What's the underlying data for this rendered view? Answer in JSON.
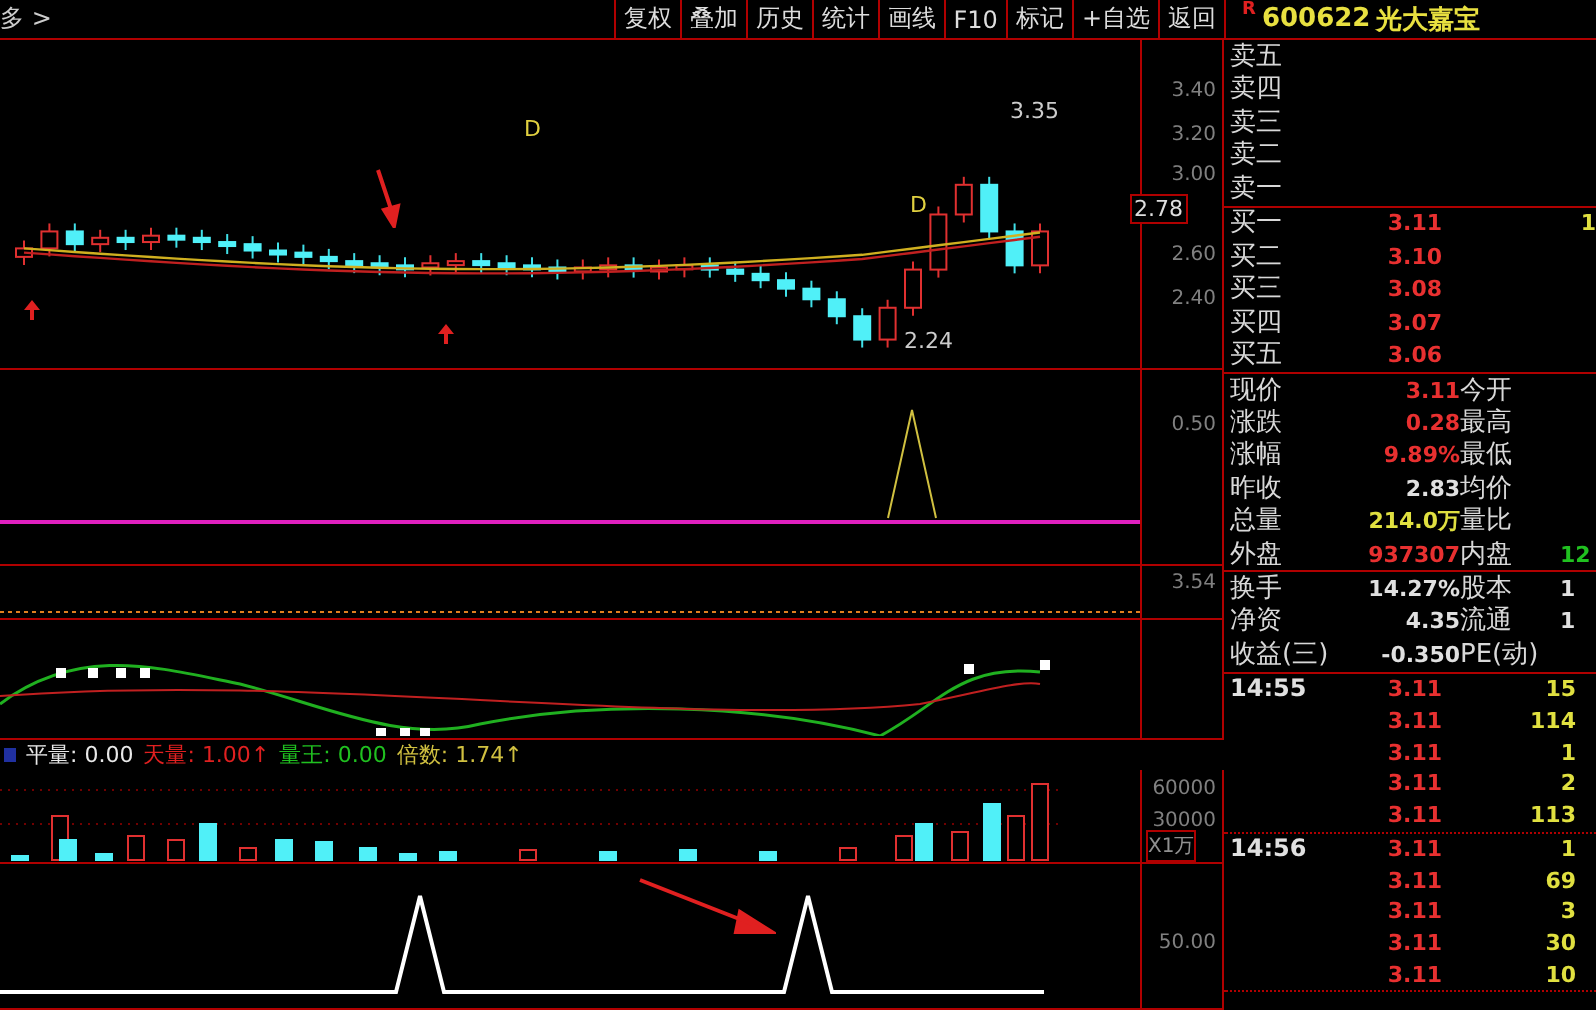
{
  "toolbar": {
    "back_label": "多 >",
    "buttons": [
      "复权",
      "叠加",
      "历史",
      "统计",
      "画线",
      "F10",
      "标记",
      "+自选",
      "返回"
    ]
  },
  "stock": {
    "badge": "R",
    "code": "600622",
    "name": "光大嘉宝"
  },
  "price_panel": {
    "ticks": [
      "3.40",
      "3.20",
      "3.00",
      "2.60",
      "2.40"
    ],
    "last_price": "2.78",
    "markers": [
      {
        "text": "D",
        "kind": "signal"
      },
      {
        "text": "D",
        "kind": "signal"
      },
      {
        "text": "3.35",
        "kind": "high"
      },
      {
        "text": "2.24",
        "kind": "low"
      }
    ]
  },
  "signal_panel": {
    "tick": "0.50"
  },
  "line_panel": {
    "tick": "3.54"
  },
  "volume_panel": {
    "legend": [
      {
        "label": "平量:",
        "value": "0.00",
        "color": "#e8e8e8"
      },
      {
        "label": "天量:",
        "value": "1.00",
        "color": "#e02020",
        "arrow": "↑"
      },
      {
        "label": "量王:",
        "value": "0.00",
        "color": "#20c020"
      },
      {
        "label": "倍数:",
        "value": "1.74",
        "color": "#d0c040",
        "arrow": "↑"
      }
    ],
    "ticks": [
      "60000",
      "30000"
    ],
    "unit": "X1万"
  },
  "bottom_panel": {
    "tick": "50.00"
  },
  "order_book": {
    "sells": [
      {
        "label": "卖五"
      },
      {
        "label": "卖四"
      },
      {
        "label": "卖三"
      },
      {
        "label": "卖二"
      },
      {
        "label": "卖一"
      }
    ],
    "buys": [
      {
        "label": "买一",
        "price": "3.11",
        "volume": "1"
      },
      {
        "label": "买二",
        "price": "3.10"
      },
      {
        "label": "买三",
        "price": "3.08"
      },
      {
        "label": "买四",
        "price": "3.07"
      },
      {
        "label": "买五",
        "price": "3.06"
      }
    ]
  },
  "quote": [
    {
      "label": "现价",
      "value": "3.11",
      "color": "#e83030",
      "right": {
        "label": "今开"
      }
    },
    {
      "label": "涨跌",
      "value": "0.28",
      "color": "#e83030",
      "right": {
        "label": "最高"
      }
    },
    {
      "label": "涨幅",
      "value": "9.89%",
      "color": "#e83030",
      "right": {
        "label": "最低"
      }
    },
    {
      "label": "昨收",
      "value": "2.83",
      "color": "#e0e0e0",
      "right": {
        "label": "均价"
      }
    },
    {
      "label": "总量",
      "value": "214.0万",
      "color": "#e0e040",
      "right": {
        "label": "量比"
      }
    },
    {
      "label": "外盘",
      "value": "937307",
      "color": "#e83030",
      "right": {
        "label": "内盘",
        "value": "12",
        "color": "#20c020"
      }
    }
  ],
  "fundamentals": [
    {
      "label": "换手",
      "value": "14.27%",
      "label2": "股本",
      "value2": "1"
    },
    {
      "label": "净资",
      "value": "4.35",
      "label2": "流通",
      "value2": "1"
    },
    {
      "label": "收益(三)",
      "value": "-0.350",
      "label2": "PE(动)"
    }
  ],
  "ticks": [
    {
      "time": "14:55",
      "rows": [
        {
          "price": "3.11",
          "volume": "15"
        },
        {
          "price": "3.11",
          "volume": "114"
        },
        {
          "price": "3.11",
          "volume": "1"
        },
        {
          "price": "3.11",
          "volume": "2"
        },
        {
          "price": "3.11",
          "volume": "113"
        }
      ]
    },
    {
      "time": "14:56",
      "rows": [
        {
          "price": "3.11",
          "volume": "1"
        },
        {
          "price": "3.11",
          "volume": "69"
        },
        {
          "price": "3.11",
          "volume": "3"
        },
        {
          "price": "3.11",
          "volume": "30"
        },
        {
          "price": "3.11",
          "volume": "10"
        }
      ]
    }
  ]
}
